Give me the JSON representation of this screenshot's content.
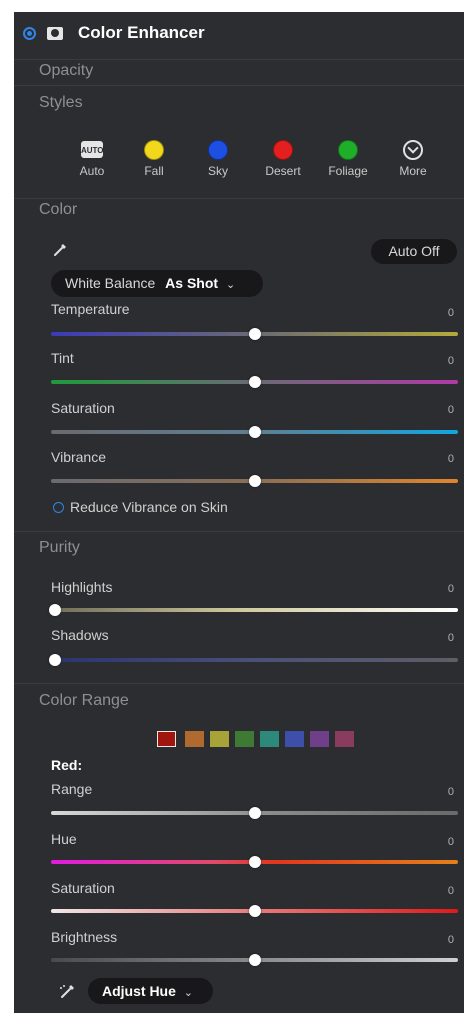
{
  "header": {
    "title": "Color Enhancer"
  },
  "sections": {
    "opacity": "Opacity",
    "styles": "Styles",
    "color": "Color",
    "purity": "Purity",
    "color_range": "Color Range"
  },
  "styles": [
    {
      "label": "Auto",
      "badge": "AUTO"
    },
    {
      "label": "Fall",
      "color": "#f2d81c"
    },
    {
      "label": "Sky",
      "color": "#1d4fe3"
    },
    {
      "label": "Desert",
      "color": "#e41f1f"
    },
    {
      "label": "Foliage",
      "color": "#1fae2a"
    },
    {
      "label": "More",
      "icon": "chevron-circle-down-icon"
    }
  ],
  "color": {
    "auto_button": "Auto Off",
    "white_balance": {
      "label": "White Balance",
      "value": "As Shot"
    },
    "sliders": [
      {
        "label": "Temperature",
        "value": "0",
        "level": 0.5
      },
      {
        "label": "Tint",
        "value": "0",
        "level": 0.5
      },
      {
        "label": "Saturation",
        "value": "0",
        "level": 0.5
      },
      {
        "label": "Vibrance",
        "value": "0",
        "level": 0.5
      }
    ],
    "reduce_vibrance": "Reduce Vibrance on Skin"
  },
  "purity": {
    "sliders": [
      {
        "label": "Highlights",
        "value": "0",
        "level": 0.0
      },
      {
        "label": "Shadows",
        "value": "0",
        "level": 0.0
      }
    ]
  },
  "color_range": {
    "swatches": [
      "#a1150f",
      "#b06a2f",
      "#a8a338",
      "#3f7a35",
      "#2d8a7a",
      "#3d4fa8",
      "#6f3f8a",
      "#8a3c5e"
    ],
    "selected": "Red:",
    "sliders": [
      {
        "label": "Range",
        "value": "0",
        "level": 0.5
      },
      {
        "label": "Hue",
        "value": "0",
        "level": 0.5
      },
      {
        "label": "Saturation",
        "value": "0",
        "level": 0.5
      },
      {
        "label": "Brightness",
        "value": "0",
        "level": 0.5
      }
    ],
    "adjust_button": "Adjust Hue"
  }
}
